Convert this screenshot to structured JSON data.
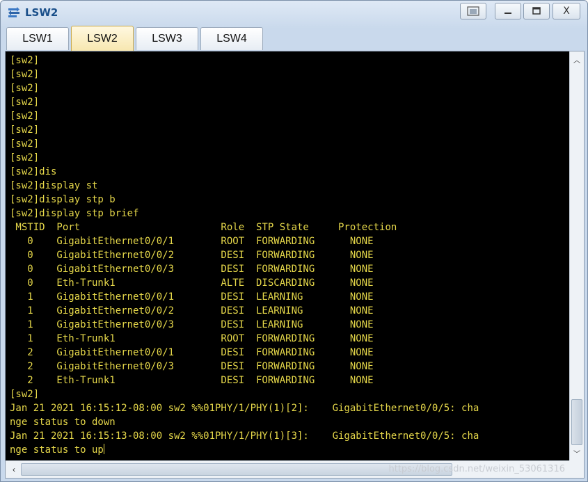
{
  "window": {
    "title": "LSW2",
    "controls": {
      "restore": "▭",
      "minimize": "—",
      "maximize": "□",
      "close": "X"
    }
  },
  "tabs": [
    {
      "label": "LSW1",
      "active": false
    },
    {
      "label": "LSW2",
      "active": true
    },
    {
      "label": "LSW3",
      "active": false
    },
    {
      "label": "LSW4",
      "active": false
    }
  ],
  "terminal": {
    "lines": [
      "[sw2]",
      "[sw2]",
      "[sw2]",
      "[sw2]",
      "[sw2]",
      "[sw2]",
      "[sw2]",
      "[sw2]",
      "[sw2]dis",
      "[sw2]display st",
      "[sw2]display stp b",
      "[sw2]display stp brief",
      " MSTID  Port                        Role  STP State     Protection",
      "   0    GigabitEthernet0/0/1        ROOT  FORWARDING      NONE",
      "   0    GigabitEthernet0/0/2        DESI  FORWARDING      NONE",
      "   0    GigabitEthernet0/0/3        DESI  FORWARDING      NONE",
      "   0    Eth-Trunk1                  ALTE  DISCARDING      NONE",
      "   1    GigabitEthernet0/0/1        DESI  LEARNING        NONE",
      "   1    GigabitEthernet0/0/2        DESI  LEARNING        NONE",
      "   1    GigabitEthernet0/0/3        DESI  LEARNING        NONE",
      "   1    Eth-Trunk1                  ROOT  FORWARDING      NONE",
      "   2    GigabitEthernet0/0/1        DESI  FORWARDING      NONE",
      "   2    GigabitEthernet0/0/3        DESI  FORWARDING      NONE",
      "   2    Eth-Trunk1                  DESI  FORWARDING      NONE",
      "[sw2]",
      "Jan 21 2021 16:15:12-08:00 sw2 %%01PHY/1/PHY(1)[2]:    GigabitEthernet0/0/5: cha",
      "nge status to down",
      "Jan 21 2021 16:15:13-08:00 sw2 %%01PHY/1/PHY(1)[3]:    GigabitEthernet0/0/5: cha"
    ],
    "last_line": "nge status to up"
  },
  "watermark": "https://blog.csdn.net/weixin_53061316",
  "colors": {
    "terminal_text": "#e6d84a",
    "terminal_bg": "#000000",
    "title": "#1a4f8a"
  }
}
